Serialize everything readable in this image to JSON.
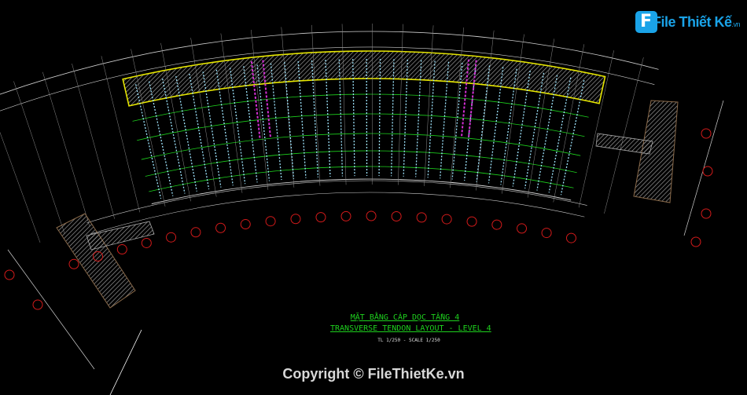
{
  "logo": {
    "icon": "F",
    "text": "File Thiết Kế",
    "suffix": ".vn"
  },
  "drawing": {
    "title_vn": "MẶT BẰNG CÁP DỌC TẦNG 4",
    "title_en": "TRANSVERSE TENDON LAYOUT - LEVEL 4",
    "scale": "TL 1/250 - SCALE 1/250"
  },
  "watermark": {
    "copyright": "Copyright © FileThietKe.vn"
  },
  "colors": {
    "background": "#000000",
    "slab_edge": "#e6e600",
    "grid_line": "#ffffff",
    "tendon": "#9fe6ff",
    "band": "#1ed11e",
    "axis_bubble": "#d21a1a",
    "beam": "#8a6a4a",
    "wall": "#d32fd3"
  }
}
